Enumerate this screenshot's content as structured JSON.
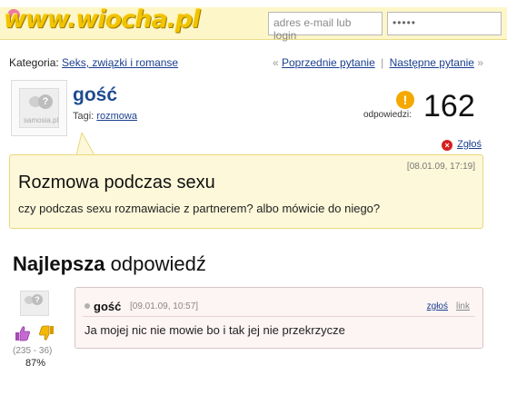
{
  "header": {
    "logo_watermark": "www.wiocha.pl",
    "email_placeholder": "adres e-mail lub login",
    "password_mask": "•••••"
  },
  "breadcrumb": {
    "label": "Kategoria:",
    "category": "Seks, związki i romanse"
  },
  "nav": {
    "prev_arrow": "«",
    "prev": "Poprzednie pytanie",
    "separator": "|",
    "next": "Następne pytanie",
    "next_arrow": "»"
  },
  "question": {
    "avatar_caption": "samosia.pl",
    "author": "gość",
    "tags_label": "Tagi:",
    "tag": "rozmowa",
    "answers_label": "odpowiedzi:",
    "answers_count": "162",
    "report_label": "Zgłoś",
    "date": "[08.01.09, 17:19]",
    "title": "Rozmowa podczas sexu",
    "body": "czy podczas sexu rozmawiacie z partnerem? albo mówicie do niego?"
  },
  "best_answer": {
    "heading_bold": "Najlepsza",
    "heading_rest": "odpowiedź",
    "avatar_caption": "samosia.pl",
    "author": "gość",
    "date": "[09.01.09, 10:57]",
    "report_label": "zgłoś",
    "link_label": "link",
    "body": "Ja mojej nic nie mowie bo i tak jej nie przekrzycze",
    "votes": "(235 - 36)",
    "percent": "87%"
  },
  "colors": {
    "link": "#1a3f8f",
    "author": "#1e4b8f",
    "question_bg": "#fdf8d9",
    "answer_bg": "#fdf4f4",
    "topbar_bg": "#fdf6c8"
  },
  "icons": {
    "answers": "question-bubble-icon",
    "report": "close-circle-icon",
    "vote_up": "thumbs-up-icon",
    "vote_down": "thumbs-down-icon"
  }
}
